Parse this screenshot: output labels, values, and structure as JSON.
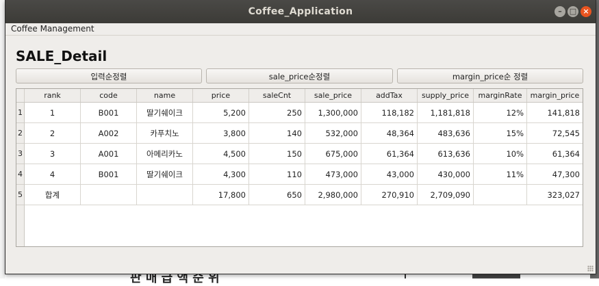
{
  "window": {
    "title": "Coffee_Application"
  },
  "menu": {
    "items": [
      "Coffee Management"
    ]
  },
  "page": {
    "heading": "SALE_Detail"
  },
  "buttons": {
    "sort_input": "입력순정렬",
    "sort_sale_price": "sale_price순정렬",
    "sort_margin_price": "margin_price순 정렬"
  },
  "table": {
    "columns": [
      "rank",
      "code",
      "name",
      "price",
      "saleCnt",
      "sale_price",
      "addTax",
      "supply_price",
      "marginRate",
      "margin_price"
    ],
    "row_numbers": [
      "1",
      "2",
      "3",
      "4",
      "5"
    ],
    "rows": [
      [
        "1",
        "B001",
        "딸기쉐이크",
        "5,200",
        "250",
        "1,300,000",
        "118,182",
        "1,181,818",
        "12%",
        "141,818"
      ],
      [
        "2",
        "A002",
        "카푸치노",
        "3,800",
        "140",
        "532,000",
        "48,364",
        "483,636",
        "15%",
        "72,545"
      ],
      [
        "3",
        "A001",
        "아메리카노",
        "4,500",
        "150",
        "675,000",
        "61,364",
        "613,636",
        "10%",
        "61,364"
      ],
      [
        "4",
        "B001",
        "딸기쉐이크",
        "4,300",
        "110",
        "473,000",
        "43,000",
        "430,000",
        "11%",
        "47,300"
      ],
      [
        "합계",
        "",
        "",
        "17,800",
        "650",
        "2,980,000",
        "270,910",
        "2,709,090",
        "",
        "323,027"
      ]
    ]
  },
  "background": {
    "bottom_text": "판 매 급 액 순 위"
  }
}
